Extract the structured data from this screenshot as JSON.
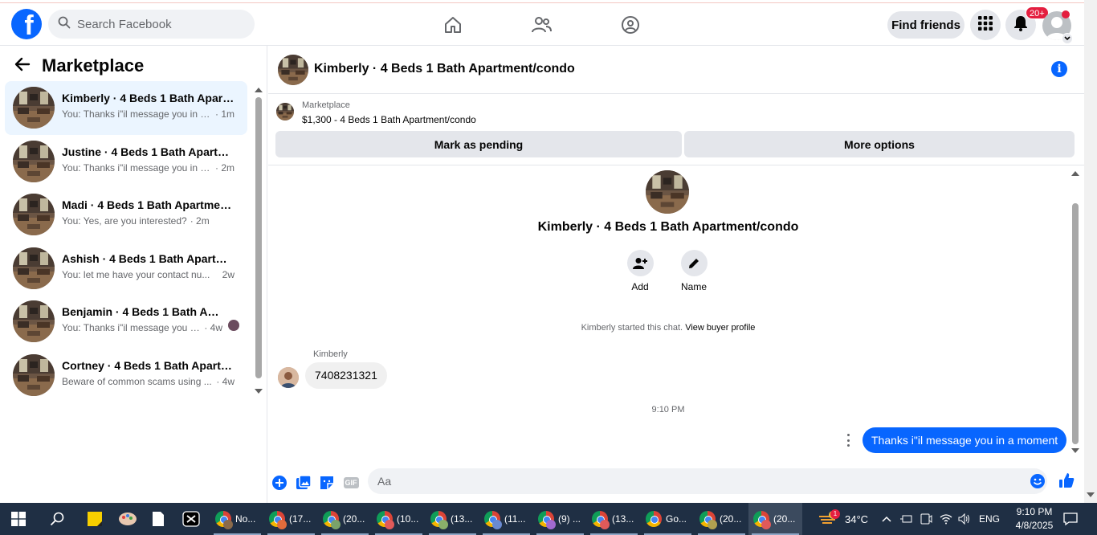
{
  "topnav": {
    "logo_letter": "f",
    "search_placeholder": "Search Facebook",
    "find_friends_label": "Find friends",
    "notifications_badge": "20+"
  },
  "sidebar": {
    "title": "Marketplace",
    "conversations": [
      {
        "title": "Kimberly · 4 Beds 1 Bath Apart...",
        "preview": "You: Thanks i\"il message you in a ...",
        "time": "· 1m",
        "active": true
      },
      {
        "title": "Justine · 4 Beds 1 Bath Apartme...",
        "preview": "You: Thanks i\"il message you in a ...",
        "time": "· 2m",
        "active": false
      },
      {
        "title": "Madi · 4 Beds 1 Bath Apartment...",
        "preview": "You: Yes, are you interested?",
        "time": "· 2m",
        "active": false
      },
      {
        "title": "Ashish · 4 Beds 1 Bath Apartme...",
        "preview": "You: let me have your contact nu...",
        "time": "2w",
        "active": false
      },
      {
        "title": "Benjamin · 4 Beds 1 Bath Apar...",
        "preview": "You: Thanks i\"il message you in...",
        "time": "· 4w",
        "active": false
      },
      {
        "title": "Cortney · 4 Beds 1 Bath Apartm...",
        "preview": "Beware of common scams using ...",
        "time": "· 4w",
        "active": false
      }
    ]
  },
  "chat": {
    "header_name": "Kimberly · 4 Beds 1 Bath Apartment/condo",
    "listing": {
      "label": "Marketplace",
      "title": "$1,300 - 4 Beds 1 Bath Apartment/condo",
      "mark_pending_label": "Mark as pending",
      "more_options_label": "More options"
    },
    "intro": {
      "name": "Kimberly · 4 Beds 1 Bath Apartment/condo",
      "add_label": "Add",
      "name_label": "Name"
    },
    "system_message": "Kimberly started this chat.",
    "system_link": "View buyer profile",
    "incoming": {
      "sender": "Kimberly",
      "text": "7408231321"
    },
    "time_separator": "9:10 PM",
    "outgoing": {
      "text": "Thanks i\"il message you in a moment"
    },
    "composer": {
      "placeholder": "Aa",
      "gif_label": "GIF"
    }
  },
  "taskbar": {
    "apps": [
      {
        "label": "No...",
        "sub_color": "#8a6a4a"
      },
      {
        "label": "(17...",
        "sub_color": "#e06c3c"
      },
      {
        "label": "(20...",
        "sub_color": "#7aa36a"
      },
      {
        "label": "(10...",
        "sub_color": "#e05a5a"
      },
      {
        "label": "(13...",
        "sub_color": "#8ab06a"
      },
      {
        "label": "(11...",
        "sub_color": "#6a8ad0"
      },
      {
        "label": "(9) ...",
        "sub_color": "#a06ad0"
      },
      {
        "label": "(13...",
        "sub_color": "#e05a5a"
      },
      {
        "label": "Go...",
        "sub_color": ""
      },
      {
        "label": "(20...",
        "sub_color": "#b0a050"
      },
      {
        "label": "(20...",
        "sub_color": "#e05a5a"
      }
    ],
    "weather_badge": "1",
    "temperature": "34°C",
    "language": "ENG",
    "time": "9:10 PM",
    "date": "4/8/2025"
  },
  "colors": {
    "facebook_blue": "#0866ff",
    "active_conversation": "#ebf5ff",
    "notification_red": "#e41e3f",
    "taskbar_bg": "#1f2f44"
  }
}
